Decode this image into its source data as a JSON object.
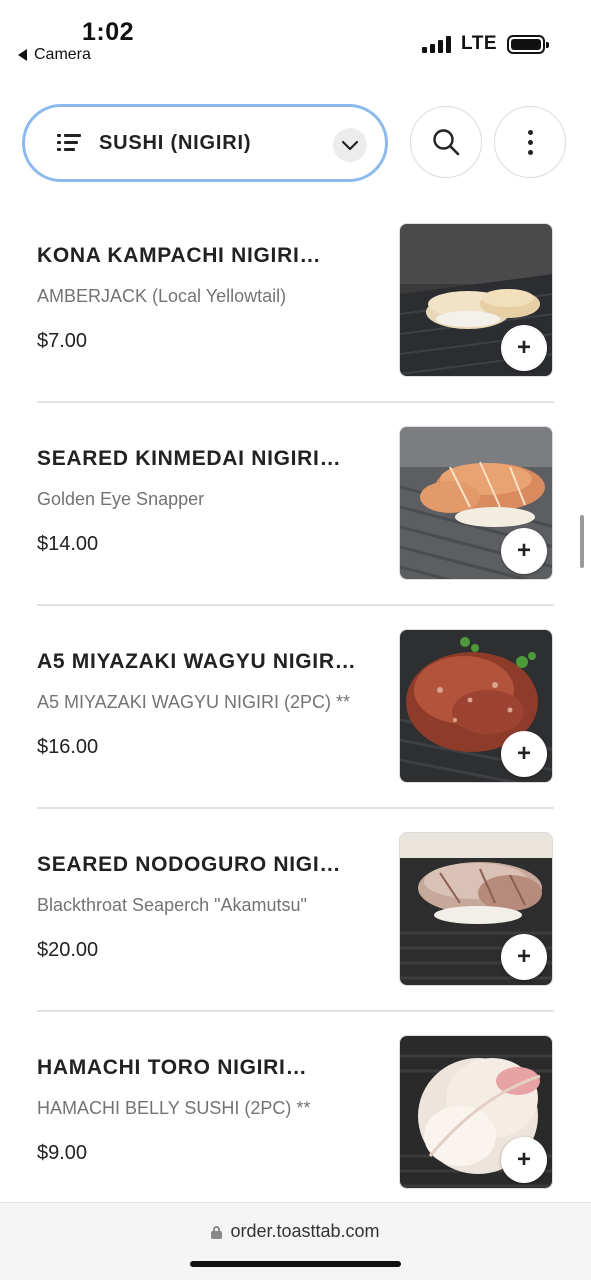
{
  "status_bar": {
    "time": "1:02",
    "back_label": "Camera",
    "network": "LTE"
  },
  "header": {
    "category": "SUSHI (NIGIRI)",
    "icons": [
      "list-icon",
      "chevron-down-icon",
      "search-icon",
      "more-vertical-icon"
    ]
  },
  "menu": {
    "items": [
      {
        "name": "KONA KAMPACHI NIGIRI…",
        "description": "AMBERJACK (Local Yellowtail)",
        "price": "$7.00",
        "add_label": "+"
      },
      {
        "name": "SEARED KINMEDAI NIGIRI…",
        "description": "Golden Eye Snapper",
        "price": "$14.00",
        "add_label": "+"
      },
      {
        "name": "A5 MIYAZAKI WAGYU NIGIR…",
        "description": "A5 MIYAZAKI WAGYU NIGIRI (2PC) **",
        "price": "$16.00",
        "add_label": "+"
      },
      {
        "name": "SEARED NODOGURO NIGI…",
        "description": "Blackthroat Seaperch \"Akamutsu\"",
        "price": "$20.00",
        "add_label": "+"
      },
      {
        "name": "HAMACHI TORO NIGIRI…",
        "description": "HAMACHI BELLY SUSHI (2PC) **",
        "price": "$9.00",
        "add_label": "+"
      }
    ]
  },
  "browser": {
    "url": "order.toasttab.com"
  },
  "colors": {
    "select_border": "#8bb9ee",
    "text_primary": "#222222",
    "text_secondary": "#737373"
  }
}
